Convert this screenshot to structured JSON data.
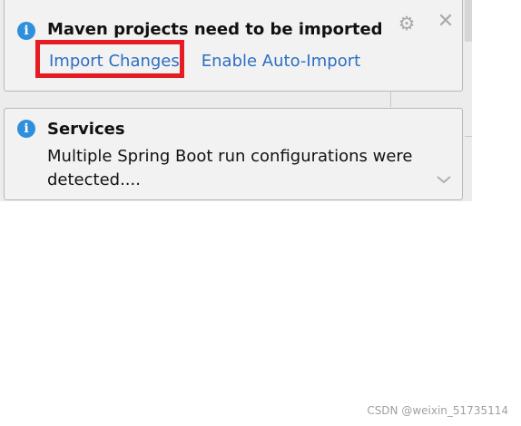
{
  "notifications": [
    {
      "title": "Maven projects need to be imported",
      "icon": "info-icon",
      "actions": {
        "import_changes": "Import Changes",
        "enable_auto_import": "Enable Auto-Import"
      },
      "highlight_color": "#e51c23"
    },
    {
      "title": "Services",
      "icon": "info-icon",
      "message": "Multiple Spring Boot run configurations were detected...."
    }
  ],
  "colors": {
    "link": "#2d6fc2",
    "info_icon": "#2f8fdb",
    "balloon_bg": "#f2f2f2"
  },
  "watermark": "CSDN @weixin_51735114"
}
